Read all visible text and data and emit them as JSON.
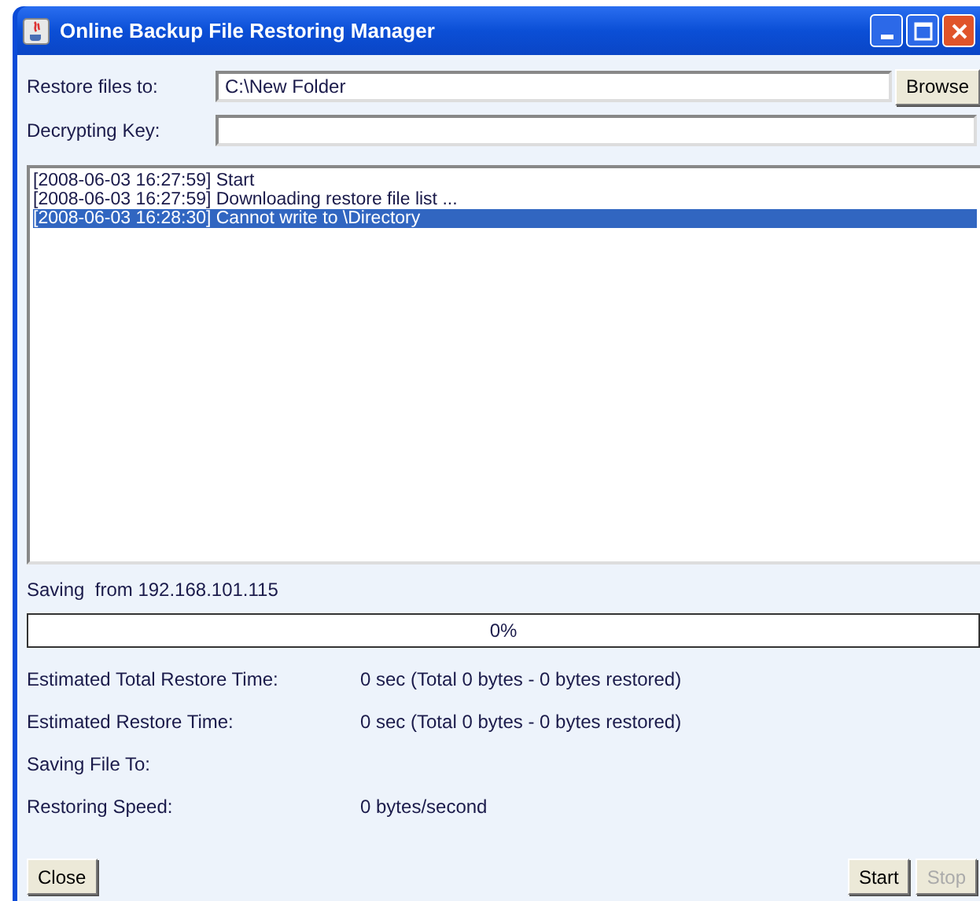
{
  "window": {
    "title": "Online Backup File Restoring Manager"
  },
  "restore_to": {
    "label": "Restore files to:",
    "value": "C:\\New Folder",
    "browse": "Browse"
  },
  "decrypting_key": {
    "label": "Decrypting Key:"
  },
  "log": [
    {
      "text": "[2008-06-03 16:27:59] Start",
      "selected": false
    },
    {
      "text": "[2008-06-03 16:27:59] Downloading restore file list ...",
      "selected": false
    },
    {
      "text": "[2008-06-03 16:28:30] Cannot write to \\Directory",
      "selected": true
    }
  ],
  "source": "Saving  from 192.168.101.115",
  "progress": {
    "level": 0,
    "label": "0%"
  },
  "stats": [
    {
      "label": "Estimated Total Restore Time:",
      "value": "0 sec (Total 0 bytes - 0 bytes restored)"
    },
    {
      "label": "Estimated Restore Time:",
      "value": "0 sec (Total 0 bytes - 0 bytes restored)"
    },
    {
      "label": "Saving File To:"
    },
    {
      "label": "Restoring Speed:",
      "value": "0 bytes/second"
    }
  ],
  "buttons": [
    {
      "label": "Close",
      "disabled": false
    },
    {
      "label": "Start",
      "disabled": false
    },
    {
      "label": "Stop",
      "disabled": true
    }
  ]
}
